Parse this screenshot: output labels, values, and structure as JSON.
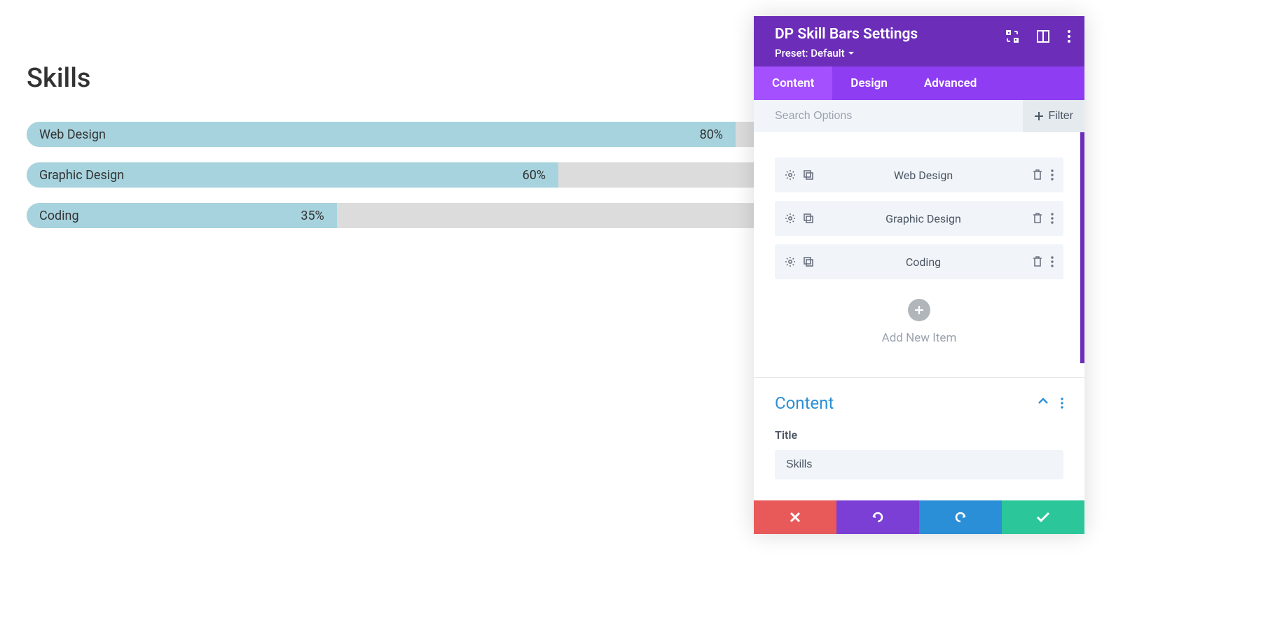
{
  "preview": {
    "title": "Skills",
    "bars": [
      {
        "label": "Web Design",
        "pct_text": "80%",
        "pct": 80
      },
      {
        "label": "Graphic Design",
        "pct_text": "60%",
        "pct": 60
      },
      {
        "label": "Coding",
        "pct_text": "35%",
        "pct": 35
      }
    ]
  },
  "panel": {
    "title": "DP Skill Bars Settings",
    "preset_label": "Preset: Default",
    "tabs": {
      "content": "Content",
      "design": "Design",
      "advanced": "Advanced"
    },
    "search_placeholder": "Search Options",
    "filter_label": "Filter",
    "items": [
      {
        "label": "Web Design"
      },
      {
        "label": "Graphic Design"
      },
      {
        "label": "Coding"
      }
    ],
    "add_new_label": "Add New Item",
    "content_section": {
      "heading": "Content",
      "title_field_label": "Title",
      "title_value": "Skills"
    }
  }
}
